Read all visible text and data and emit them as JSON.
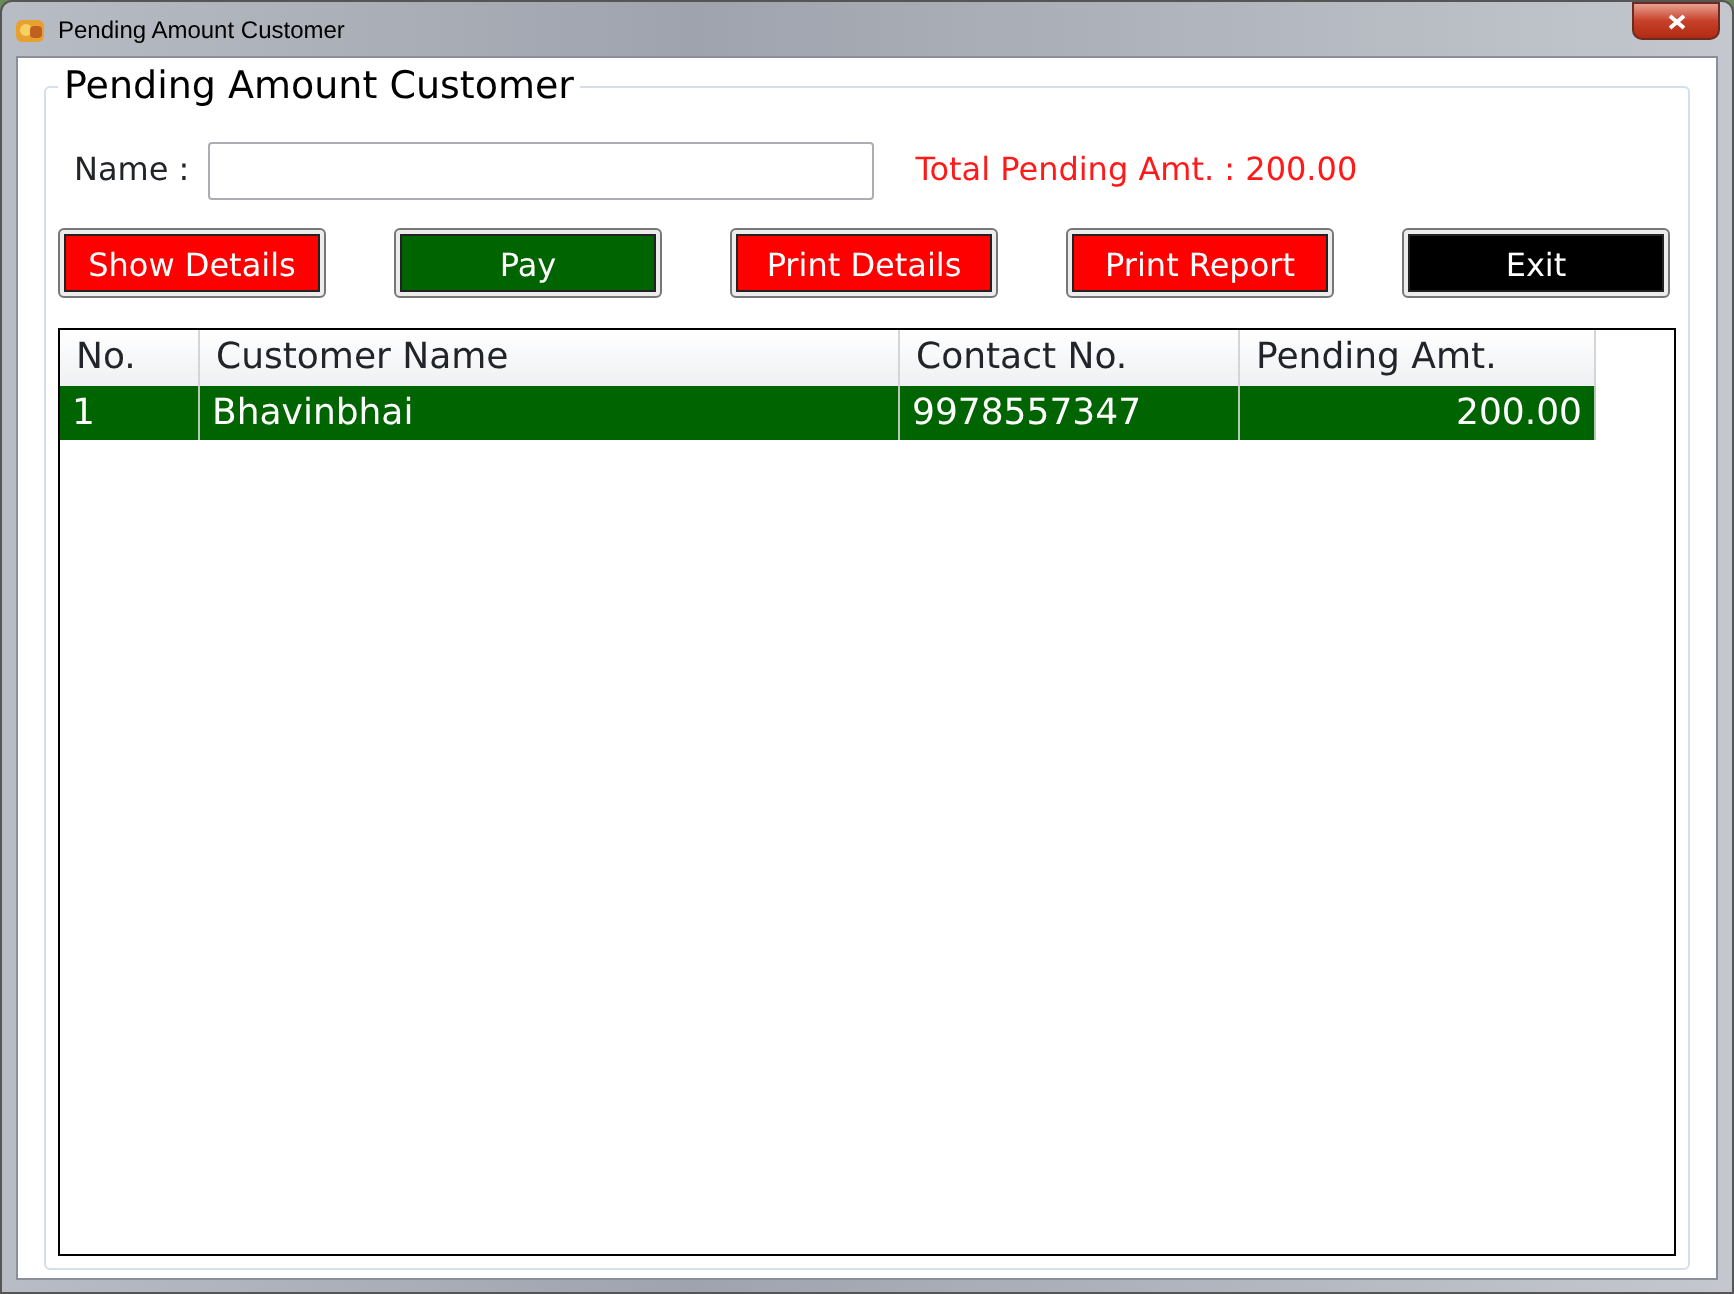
{
  "window": {
    "title": "Pending Amount Customer"
  },
  "group": {
    "title": "Pending Amount Customer"
  },
  "name_field": {
    "label": "Name :"
  },
  "total": "Total Pending Amt. : 200.00",
  "buttons": [
    {
      "label": "Show Details",
      "color": "#ff0000"
    },
    {
      "label": "Pay",
      "color": "#006400"
    },
    {
      "label": "Print Details",
      "color": "#ff0000"
    },
    {
      "label": "Print Report",
      "color": "#ff0000"
    },
    {
      "label": "Exit",
      "color": "#000000"
    }
  ],
  "table": {
    "columns": [
      "No.",
      "Customer Name",
      "Contact No.",
      "Pending Amt."
    ],
    "rows": [
      {
        "cells": [
          "1",
          "Bhavinbhai",
          "9978557347",
          "200.00"
        ],
        "selected": true
      }
    ]
  }
}
